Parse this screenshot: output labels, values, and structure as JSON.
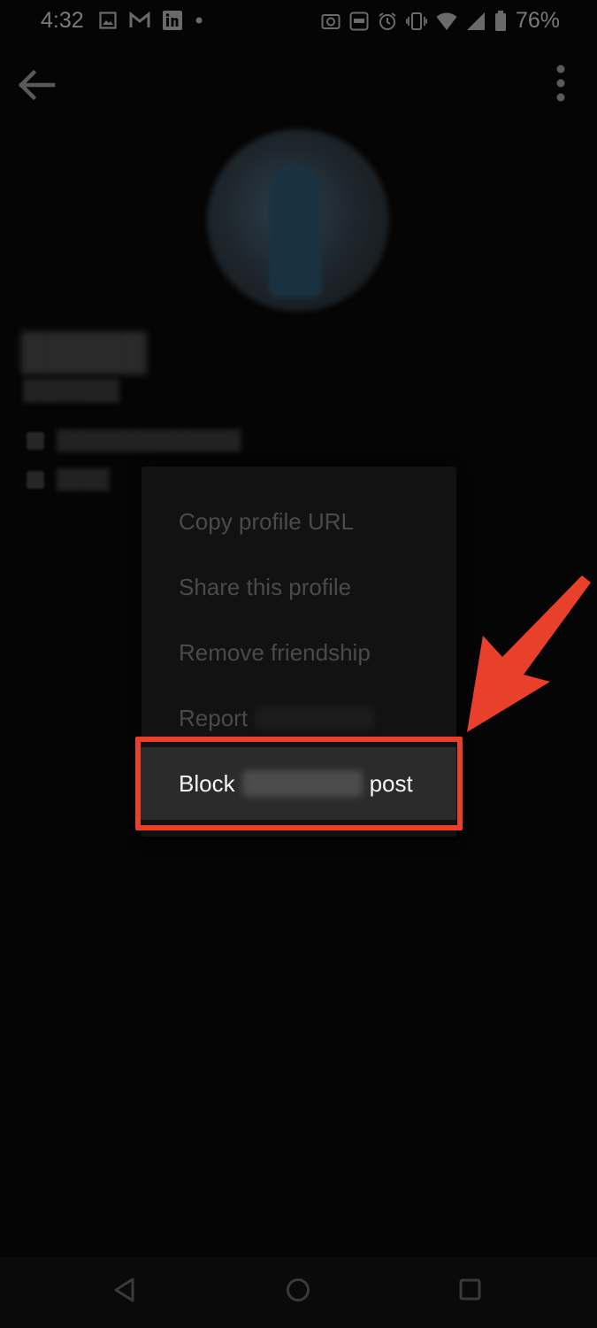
{
  "status_bar": {
    "time": "4:32",
    "left_icons": [
      "image-icon",
      "gmail-icon",
      "linkedin-icon",
      "dot-icon"
    ],
    "right_icons": [
      "screenshot-icon",
      "auto-brightness-icon",
      "alarm-icon",
      "vibrate-icon",
      "wifi-icon",
      "signal-icon",
      "battery-icon"
    ],
    "battery": "76%"
  },
  "app_bar": {
    "back_icon": "arrow-left-icon",
    "more_icon": "more-vertical-icon"
  },
  "menu": {
    "items": [
      {
        "label": "Copy profile URL"
      },
      {
        "label": "Share this profile"
      },
      {
        "label": "Remove friendship"
      },
      {
        "label": "Report"
      }
    ],
    "block": {
      "prefix": "Block",
      "suffix": "post"
    }
  },
  "annotation": {
    "color": "#e8402a"
  },
  "nav_bar": {
    "icons": [
      "nav-back-icon",
      "nav-home-icon",
      "nav-recents-icon"
    ]
  },
  "colors": {
    "background": "#050505",
    "menu_background": "#121212",
    "menu_highlight": "#2b2b2b",
    "annotation_red": "#e8402a"
  }
}
